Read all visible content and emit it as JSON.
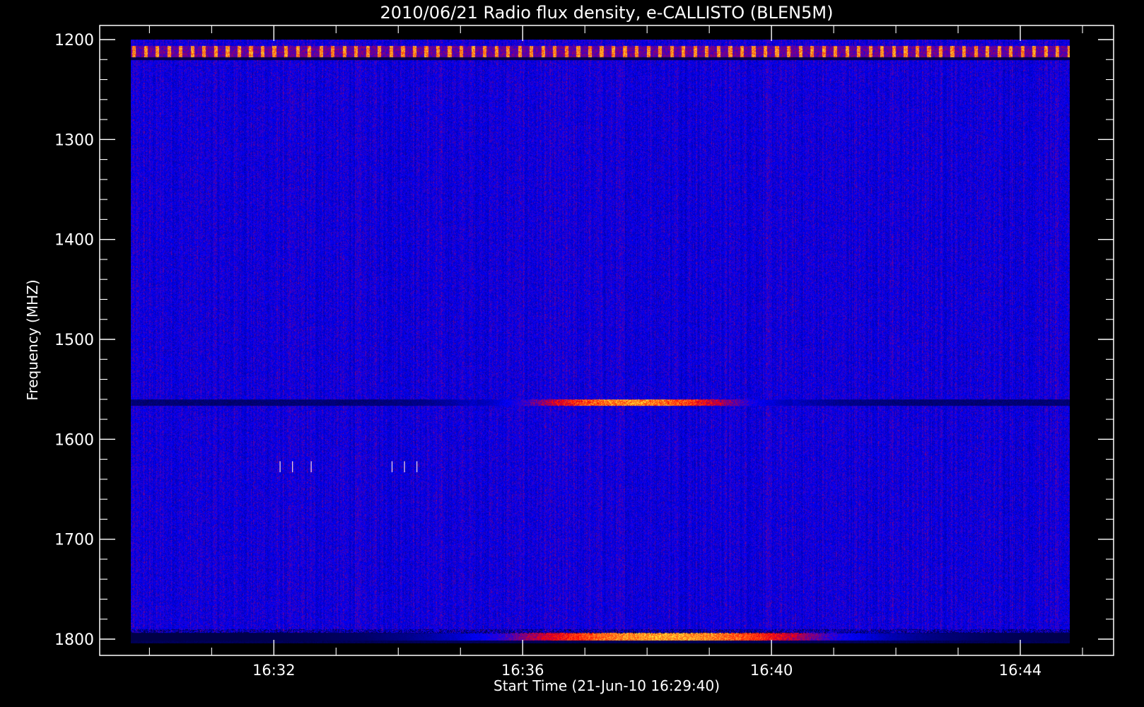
{
  "chart_data": {
    "type": "heatmap",
    "title": "2010/06/21  Radio flux density, e-CALLISTO (BLEN5M)",
    "xlabel": "Start Time (21-Jun-10 16:29:40)",
    "ylabel": "Frequency (MHZ)",
    "x_ticks": [
      "16:32",
      "16:36",
      "16:40",
      "16:44"
    ],
    "x_tick_minutes": [
      152.0,
      156.0,
      160.0,
      164.0
    ],
    "x_range_minutes": [
      149.2,
      165.5
    ],
    "data_range_minutes": [
      149.7,
      164.8
    ],
    "y_ticks": [
      1200,
      1300,
      1400,
      1500,
      1600,
      1700,
      1800
    ],
    "ylim": [
      1800,
      1200
    ],
    "y_inverted": true,
    "colormap": [
      "#000000",
      "#0000ff",
      "#ff0000",
      "#ffff00"
    ],
    "background_level": "blue",
    "features": [
      {
        "type": "band",
        "freq_mhz": 1213,
        "description": "periodic red/yellow interference",
        "t_start": "16:29:40",
        "t_end": "16:44:50"
      },
      {
        "type": "band",
        "freq_mhz": 1563,
        "description": "emission band",
        "peak_from": "16:36",
        "peak_to": "16:39"
      },
      {
        "type": "band",
        "freq_mhz": 1800,
        "description": "bright lower-edge emission",
        "peak_from": "16:34",
        "peak_to": "16:41"
      },
      {
        "type": "spikes",
        "freq_mhz": 1625,
        "times": [
          "16:32",
          "16:33:30"
        ]
      }
    ]
  }
}
